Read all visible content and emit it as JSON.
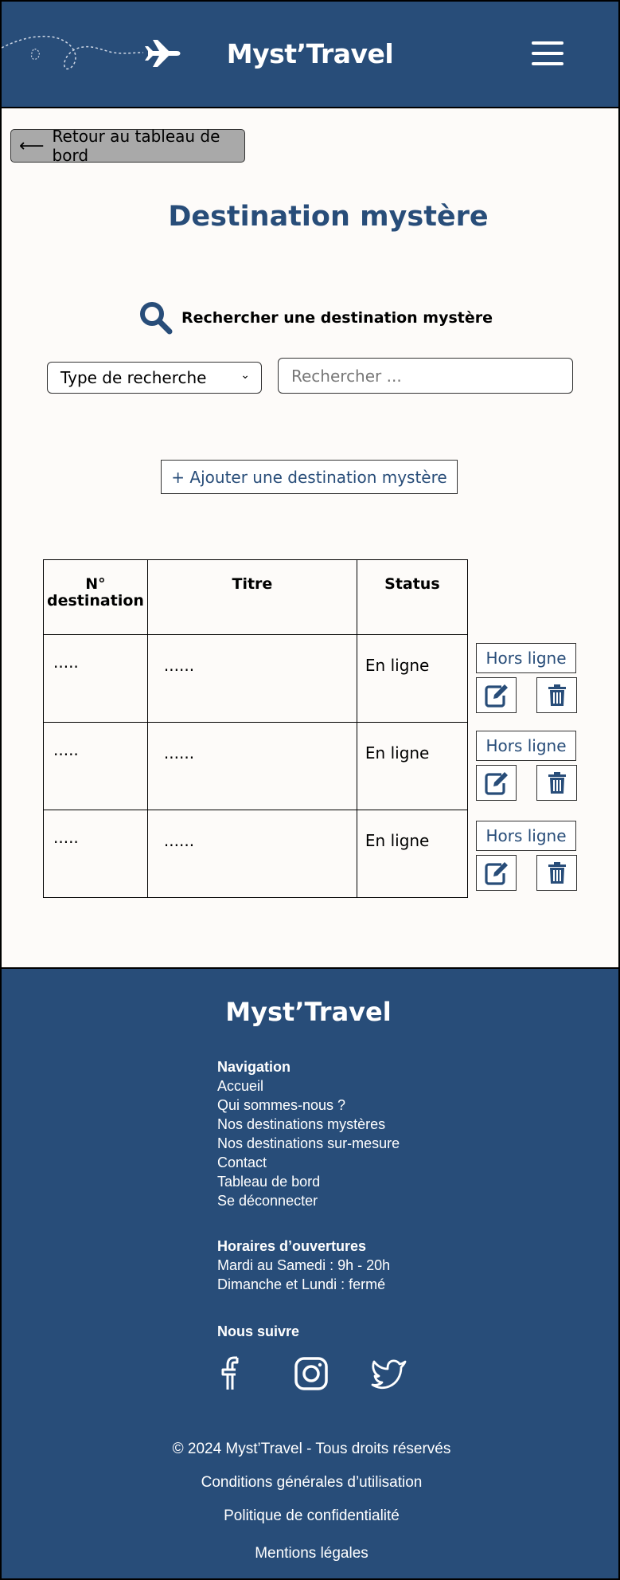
{
  "header": {
    "site_name": "Myst’Travel",
    "menu_icon": "hamburger-icon",
    "decor_icon": "airplane-icon"
  },
  "back_button": {
    "label": "Retour au tableau de bord",
    "icon": "arrow-left-icon"
  },
  "page_title": "Destination mystère",
  "search": {
    "heading": "Rechercher une destination mystère",
    "icon": "magnifier-icon",
    "type_select": "Type de recherche",
    "placeholder": "Rechercher ..."
  },
  "add_button": "+ Ajouter une destination mystère",
  "table": {
    "headers": [
      "N° destination",
      "Titre",
      "Status"
    ],
    "rows": [
      {
        "number": ".....",
        "title": "......",
        "status": "En ligne",
        "action": "Hors ligne"
      },
      {
        "number": ".....",
        "title": "......",
        "status": "En ligne",
        "action": "Hors ligne"
      },
      {
        "number": ".....",
        "title": "......",
        "status": "En ligne",
        "action": "Hors ligne"
      }
    ]
  },
  "footer": {
    "site_name": "Myst’Travel",
    "navigation": {
      "heading": "Navigation",
      "links": [
        "Accueil",
        "Qui sommes-nous ?",
        "Nos destinations mystères",
        "Nos destinations sur-mesure",
        "Contact",
        "Tableau de bord",
        "Se déconnecter"
      ]
    },
    "hours": {
      "heading": "Horaires d’ouvertures",
      "lines": [
        "Mardi au Samedi : 9h - 20h",
        "Dimanche et Lundi : fermé"
      ]
    },
    "follow": {
      "heading": "Nous suivre",
      "icons": [
        "facebook-icon",
        "instagram-icon",
        "twitter-icon"
      ]
    },
    "copyright": "© 2024 Myst’Travel - Tous droits réservés",
    "legal_links": [
      "Conditions générales d’utilisation",
      "Politique de confidentialité",
      "Mentions légales"
    ]
  },
  "colors": {
    "brand": "#284d79",
    "background": "#fdfbf9",
    "button_grey": "#a9a9a9"
  }
}
